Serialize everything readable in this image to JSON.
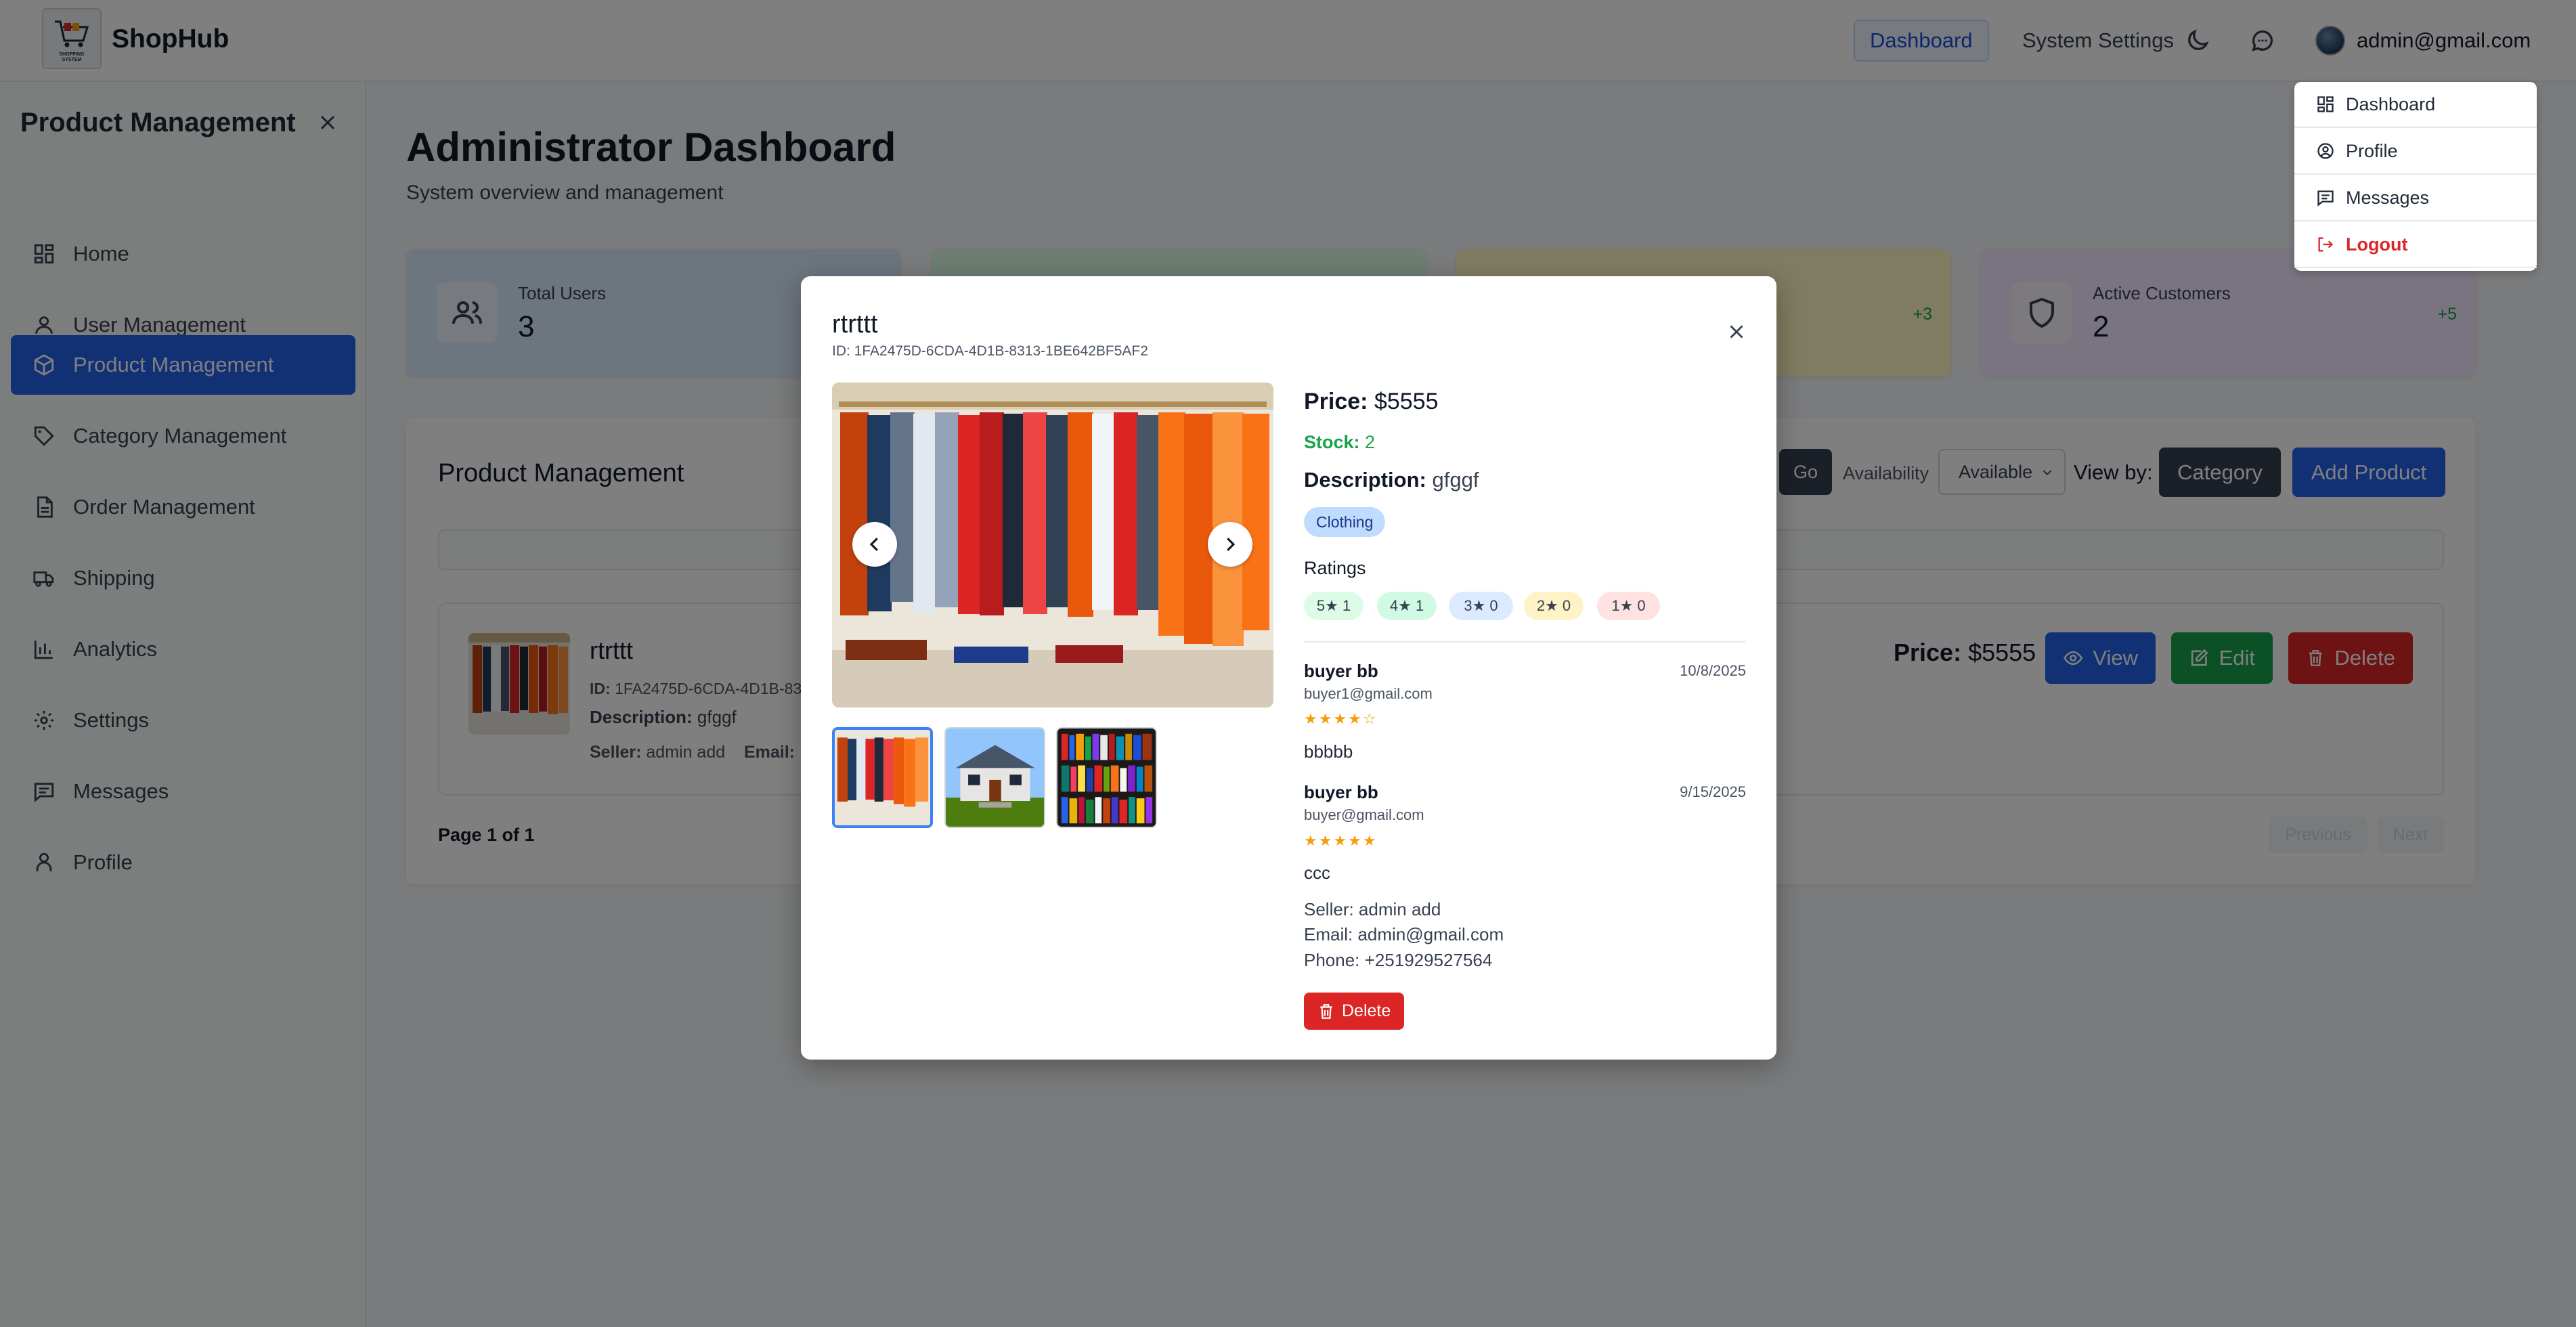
{
  "header": {
    "brand": "ShopHub",
    "logo_text": "SHOPPING SYSTEM",
    "nav": {
      "dashboard": "Dashboard",
      "system_settings": "System Settings"
    },
    "user_email": "admin@gmail.com",
    "icons": [
      "cart-logo-icon",
      "moon-icon",
      "chat-icon",
      "avatar"
    ]
  },
  "sidebar": {
    "title": "Product Management",
    "items": [
      {
        "label": "Home",
        "icon": "grid-icon"
      },
      {
        "label": "User Management",
        "icon": "user-icon"
      },
      {
        "label": "Product Management",
        "icon": "box-icon",
        "active": true
      },
      {
        "label": "Category Management",
        "icon": "tag-icon"
      },
      {
        "label": "Order Management",
        "icon": "document-icon"
      },
      {
        "label": "Shipping",
        "icon": "truck-icon"
      },
      {
        "label": "Analytics",
        "icon": "bar-chart-icon"
      },
      {
        "label": "Settings",
        "icon": "gear-icon"
      },
      {
        "label": "Messages",
        "icon": "message-icon"
      },
      {
        "label": "Profile",
        "icon": "person-icon"
      }
    ]
  },
  "main": {
    "title": "Administrator Dashboard",
    "subtitle": "System overview and management",
    "stats": [
      {
        "label": "Total Users",
        "value": "3",
        "color": "#dbeafe"
      },
      {
        "label": "",
        "value": "",
        "color": "#dcfce7"
      },
      {
        "label": "",
        "value": "",
        "delta": "+3",
        "color": "#fef9c3"
      },
      {
        "label": "Active Customers",
        "value": "2",
        "delta": "+5",
        "color": "#f3e8ff"
      }
    ]
  },
  "product_panel": {
    "title": "Product Management",
    "go": "Go",
    "availability_label": "Availability",
    "availability_value": "Available",
    "view_by": "View by:",
    "category_btn": "Category",
    "add_btn": "Add Product",
    "row": {
      "name": "rtrttt",
      "id_label": "ID:",
      "id": "1FA2475D-6CDA-4D1B-831",
      "desc_label": "Description:",
      "desc": "gfggf",
      "seller_label": "Seller:",
      "seller": "admin add",
      "email_label": "Email:",
      "price_label": "Price:",
      "price": "$5555",
      "view": "View",
      "edit": "Edit",
      "delete": "Delete"
    },
    "page_info": "Page 1 of 1",
    "prev": "Previous",
    "next": "Next"
  },
  "dropdown": {
    "items": [
      {
        "label": "Dashboard",
        "icon": "grid-icon"
      },
      {
        "label": "Profile",
        "icon": "user-circle-icon"
      },
      {
        "label": "Messages",
        "icon": "message-icon"
      },
      {
        "label": "Logout",
        "icon": "logout-icon",
        "color": "#dc2626"
      }
    ]
  },
  "modal": {
    "title": "rtrttt",
    "id_line": "ID: 1FA2475D-6CDA-4D1B-8313-1BE642BF5AF2",
    "price_label": "Price:",
    "price": "$5555",
    "stock_label": "Stock:",
    "stock": "2",
    "desc_label": "Description:",
    "desc": "gfggf",
    "category": "Clothing",
    "ratings_label": "Ratings",
    "rating_badges": [
      "5★ 1",
      "4★ 1",
      "3★ 0",
      "2★ 0",
      "1★ 0"
    ],
    "reviews": [
      {
        "name": "buyer bb",
        "email": "buyer1@gmail.com",
        "date": "10/8/2025",
        "stars": "★★★★☆",
        "rating": 4,
        "text": "bbbbb"
      },
      {
        "name": "buyer bb",
        "email": "buyer@gmail.com",
        "date": "9/15/2025",
        "stars": "★★★★★",
        "rating": 5,
        "text": "ccc"
      }
    ],
    "seller": "Seller: admin add",
    "email": "Email: admin@gmail.com",
    "phone": "Phone: +251929527564",
    "delete": "Delete"
  },
  "colors": {
    "primary": "#2563eb",
    "success": "#16a34a",
    "danger": "#dc2626",
    "dark": "#374151"
  }
}
